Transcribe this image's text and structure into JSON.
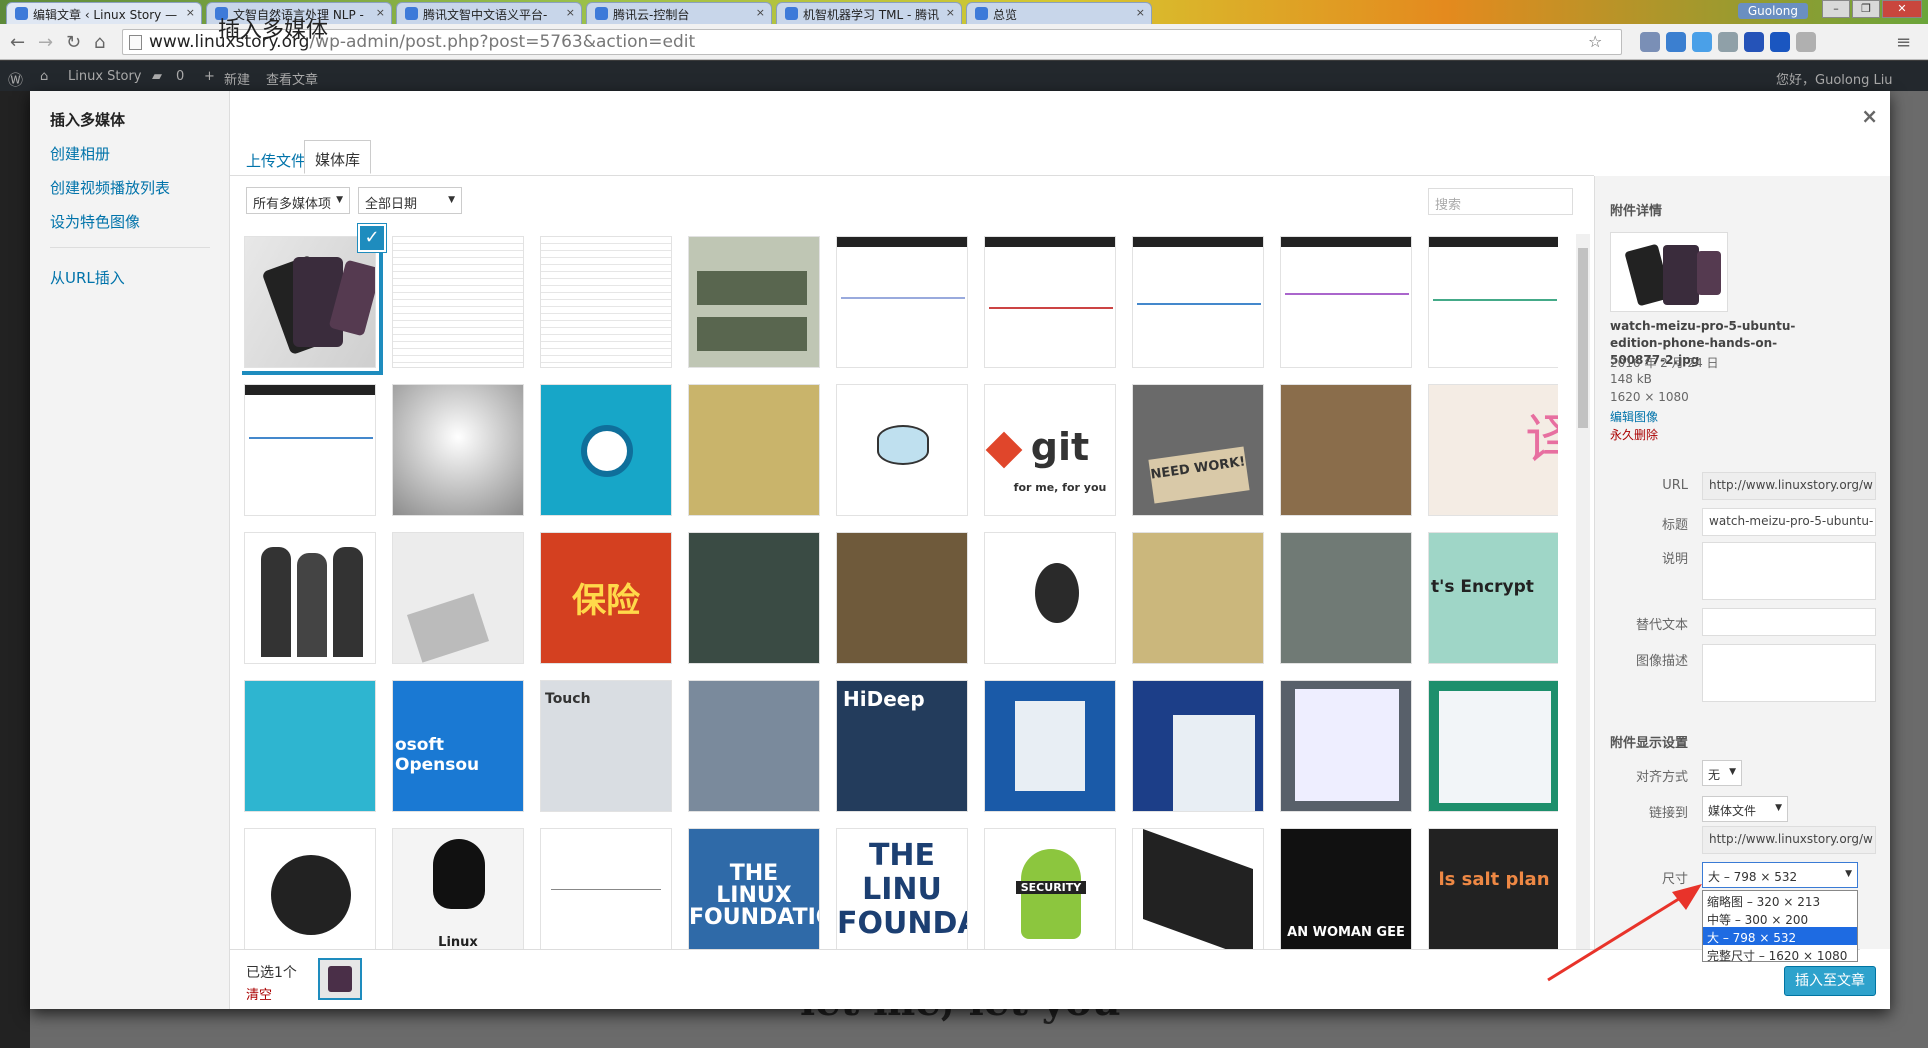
{
  "browser": {
    "tabs": [
      {
        "title": "编辑文章 ‹ Linux Story —",
        "active": true
      },
      {
        "title": "文智自然语言处理 NLP -",
        "active": false
      },
      {
        "title": "腾讯文智中文语义平台-",
        "active": false
      },
      {
        "title": "腾讯云-控制台",
        "active": false
      },
      {
        "title": "机智机器学习 TML - 腾讯",
        "active": false
      },
      {
        "title": "总览",
        "active": false
      }
    ],
    "tab_close": "×",
    "user": "Guolong",
    "url_domain": "www.linuxstory.org",
    "url_path": "/wp-admin/post.php?post=5763&action=edit"
  },
  "adminbar": {
    "site": "Linux Story",
    "comments": "0",
    "new": "新建",
    "view": "查看文章",
    "greeting": "您好，Guolong Liu"
  },
  "modal": {
    "menu": [
      "插入多媒体",
      "创建相册",
      "创建视频播放列表",
      "设为特色图像",
      "从URL插入"
    ],
    "title": "插入多媒体",
    "close": "×",
    "tabs": [
      "上传文件",
      "媒体库"
    ],
    "filter_type": "所有多媒体项",
    "filter_date": "全部日期",
    "search_placeholder": "搜索",
    "selected_count": "已选1个",
    "clear": "清空",
    "insert_button": "插入至文章",
    "thumb_captions": {
      "git": "git",
      "git_sub": "for me, for you",
      "need_work": "NEED WORK!",
      "insurance": "保险",
      "encrypt": "t's Encrypt",
      "opensource": "osoft Opensou",
      "touch": "Touch",
      "hideep": "HiDeep",
      "linux_found1": "THE LINUX FOUNDATIO",
      "linux_found2": "THE LINU FOUNDA",
      "security": "SECURITY",
      "man_woman": "AN WOMAN GEE",
      "salt": "ls salt plan",
      "powered": "Linux"
    }
  },
  "details": {
    "heading": "附件详情",
    "filename": "watch-meizu-pro-5-ubuntu-edition-phone-hands-on-500877-2.jpg",
    "date": "2016 年 2 月 24 日",
    "size": "148 kB",
    "dimensions": "1620 × 1080",
    "edit_link": "编辑图像",
    "delete_link": "永久删除",
    "labels": {
      "url": "URL",
      "title": "标题",
      "caption": "说明",
      "alt": "替代文本",
      "desc": "图像描述"
    },
    "url_value": "http://www.linuxstory.org/w",
    "title_value": "watch-meizu-pro-5-ubuntu-",
    "display_heading": "附件显示设置",
    "align_label": "对齐方式",
    "align_value": "无",
    "link_label": "链接到",
    "link_value": "媒体文件",
    "link_url": "http://www.linuxstory.org/w",
    "size_label": "尺寸",
    "size_value": "大 – 798 × 532",
    "size_options": [
      "缩略图 – 320 × 213",
      "中等 – 300 × 200",
      "大 – 798 × 532",
      "完整尺寸 – 1620 × 1080"
    ],
    "size_highlighted": 2
  },
  "colors": {
    "accent": "#1e8cbe",
    "link": "#0073aa",
    "delete": "#aa0000",
    "arrow": "#e8332a"
  }
}
